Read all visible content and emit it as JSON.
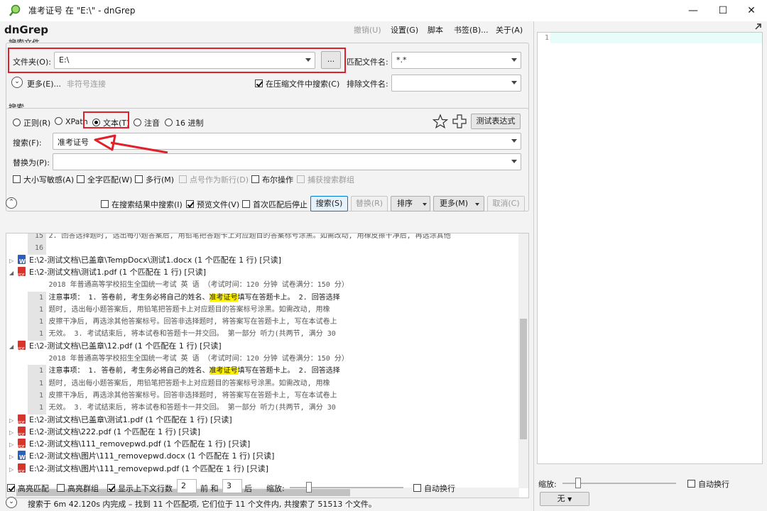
{
  "window": {
    "title": "准考证号 在 \"E:\\\" - dnGrep",
    "controls": {
      "minimize": "—",
      "maximize": "☐",
      "close": "✕"
    }
  },
  "app": {
    "name": "dnGrep",
    "menu": [
      "撤销(U)",
      "设置(G)",
      "脚本",
      "书签(B)...",
      "关于(A)"
    ]
  },
  "search_files": {
    "group_label": "搜索文件",
    "folder_label": "文件夹(O):",
    "folder_value": "E:\\",
    "browse_label": "...",
    "match_files_label": "匹配文件名:",
    "match_files_value": "*.*",
    "more_label": "更多(E)...",
    "non_symlink_label": "非符号连接",
    "search_archives_label": "在压缩文件中搜索(C)",
    "exclude_label": "排除文件名:",
    "exclude_value": ""
  },
  "search": {
    "group_label": "搜索",
    "types": [
      {
        "label": "正则(R)",
        "checked": false
      },
      {
        "label": "XPath",
        "checked": false
      },
      {
        "label": "文本(T)",
        "checked": true
      },
      {
        "label": "注音",
        "checked": false
      },
      {
        "label": "16 进制",
        "checked": false
      }
    ],
    "test_expression_label": "测试表达式",
    "search_label": "搜索(F):",
    "search_value": "准考证号",
    "replace_label": "替换为(P):",
    "replace_value": "",
    "options": [
      {
        "label": "大小写敏感(A)",
        "checked": false,
        "enabled": true
      },
      {
        "label": "全字匹配(W)",
        "checked": false,
        "enabled": true
      },
      {
        "label": "多行(M)",
        "checked": false,
        "enabled": true
      },
      {
        "label": "点号作为新行(D)",
        "checked": false,
        "enabled": false
      },
      {
        "label": "布尔操作",
        "checked": false,
        "enabled": true
      },
      {
        "label": "捕获搜索群组",
        "checked": false,
        "enabled": false
      }
    ]
  },
  "toolbar": {
    "search_in_results_label": "在搜索结果中搜索(I)",
    "preview_file_label": "预览文件(V)",
    "stop_after_first_label": "首次匹配后停止",
    "search_button": "搜索(S)",
    "replace_button": "替换(R)",
    "sort_button": "排序",
    "more_button": "更多(M)",
    "cancel_button": "取消(C)"
  },
  "results": {
    "top_lines": [
      {
        "no": "15",
        "text": "2. 回答选择题时, 选出每小题答案后, 用铅笔把答题卡上对应题目的答案标号涂黑。如需改动, 用橡皮擦干净后, 再选涂其他"
      },
      {
        "no": "16",
        "text": ""
      }
    ],
    "files": [
      {
        "icon": "doc",
        "expanded": false,
        "text": "E:\\2-测试文档\\已盖章\\TempDocx\\测试1.docx (1 个匹配在 1 行) [只读]"
      },
      {
        "icon": "pdf",
        "expanded": true,
        "text": "E:\\2-测试文档\\测试1.pdf (1 个匹配在 1 行) [只读]",
        "lines": [
          {
            "no": "",
            "pre": "2018 年普通高等学校招生全国统一考试 英 语 （考试时间：120 分钟 试卷满分：150 分）",
            "hl": "",
            "post": ""
          },
          {
            "no": "1",
            "pre": "注意事项： 1. 答卷前, 考生务必将自己的姓名、",
            "hl": "准考证号",
            "post": "填写在答题卡上。 2. 回答选择"
          },
          {
            "no": "1",
            "pre": "题时, 选出每小题答案后, 用铅笔把答题卡上对应题目的答案标号涂黑。如需改动, 用橡",
            "hl": "",
            "post": ""
          },
          {
            "no": "1",
            "pre": "皮擦干净后, 再选涂其他答案标号。回答非选择题时, 将答案写在答题卡上, 写在本试卷上",
            "hl": "",
            "post": ""
          },
          {
            "no": "1",
            "pre": "无效。 3. 考试结束后, 将本试卷和答题卡一并交回。 第一部分 听力(共两节, 满分 30",
            "hl": "",
            "post": ""
          }
        ]
      },
      {
        "icon": "pdf",
        "expanded": true,
        "text": "E:\\2-测试文档\\已盖章\\12.pdf (1 个匹配在 1 行) [只读]",
        "lines": [
          {
            "no": "",
            "pre": "2018 年普通高等学校招生全国统一考试 英 语 （考试时间：120 分钟 试卷满分：150 分）",
            "hl": "",
            "post": ""
          },
          {
            "no": "1",
            "pre": "注意事项： 1. 答卷前, 考生务必将自己的姓名、",
            "hl": "准考证号",
            "post": "填写在答题卡上。 2. 回答选择"
          },
          {
            "no": "1",
            "pre": "题时, 选出每小题答案后, 用铅笔把答题卡上对应题目的答案标号涂黑。如需改动, 用橡",
            "hl": "",
            "post": ""
          },
          {
            "no": "1",
            "pre": "皮擦干净后, 再选涂其他答案标号。回答非选择题时, 将答案写在答题卡上, 写在本试卷上",
            "hl": "",
            "post": ""
          },
          {
            "no": "1",
            "pre": "无效。 3. 考试结束后, 将本试卷和答题卡一并交回。 第一部分 听力(共两节, 满分 30",
            "hl": "",
            "post": ""
          }
        ]
      },
      {
        "icon": "pdf",
        "expanded": false,
        "text": "E:\\2-测试文档\\已盖章\\测试1.pdf (1 个匹配在 1 行) [只读]"
      },
      {
        "icon": "pdf",
        "expanded": false,
        "text": "E:\\2-测试文档\\222.pdf (1 个匹配在 1 行) [只读]"
      },
      {
        "icon": "pdf",
        "expanded": false,
        "text": "E:\\2-测试文档\\111_removepwd.pdf (1 个匹配在 1 行) [只读]"
      },
      {
        "icon": "doc",
        "expanded": false,
        "text": "E:\\2-测试文档\\图片\\111_removepwd.docx (1 个匹配在 1 行) [只读]"
      },
      {
        "icon": "pdf",
        "expanded": false,
        "text": "E:\\2-测试文档\\图片\\111_removepwd.pdf (1 个匹配在 1 行) [只读]"
      }
    ]
  },
  "bottom": {
    "highlight_label": "高亮匹配",
    "highlight_groups_label": "高亮群组",
    "show_context_label": "显示上下文行数",
    "before_value": "2",
    "before_label": "前 和",
    "after_value": "3",
    "after_label": "后",
    "zoom_label": "缩放:",
    "wrap_label": "自动换行",
    "status": "搜索于 6m 42.120s 内完成 – 找到 11 个匹配项, 它们位于 11 个文件内, 共搜索了 51513 个文件。"
  },
  "preview": {
    "line_no": "1",
    "zoom_label": "缩放:",
    "wrap_label": "自动换行",
    "syntax_value": "无"
  },
  "colors": {
    "highlight": "#fff200",
    "annotation_red": "#e0202a",
    "accent": "#0078d7"
  }
}
